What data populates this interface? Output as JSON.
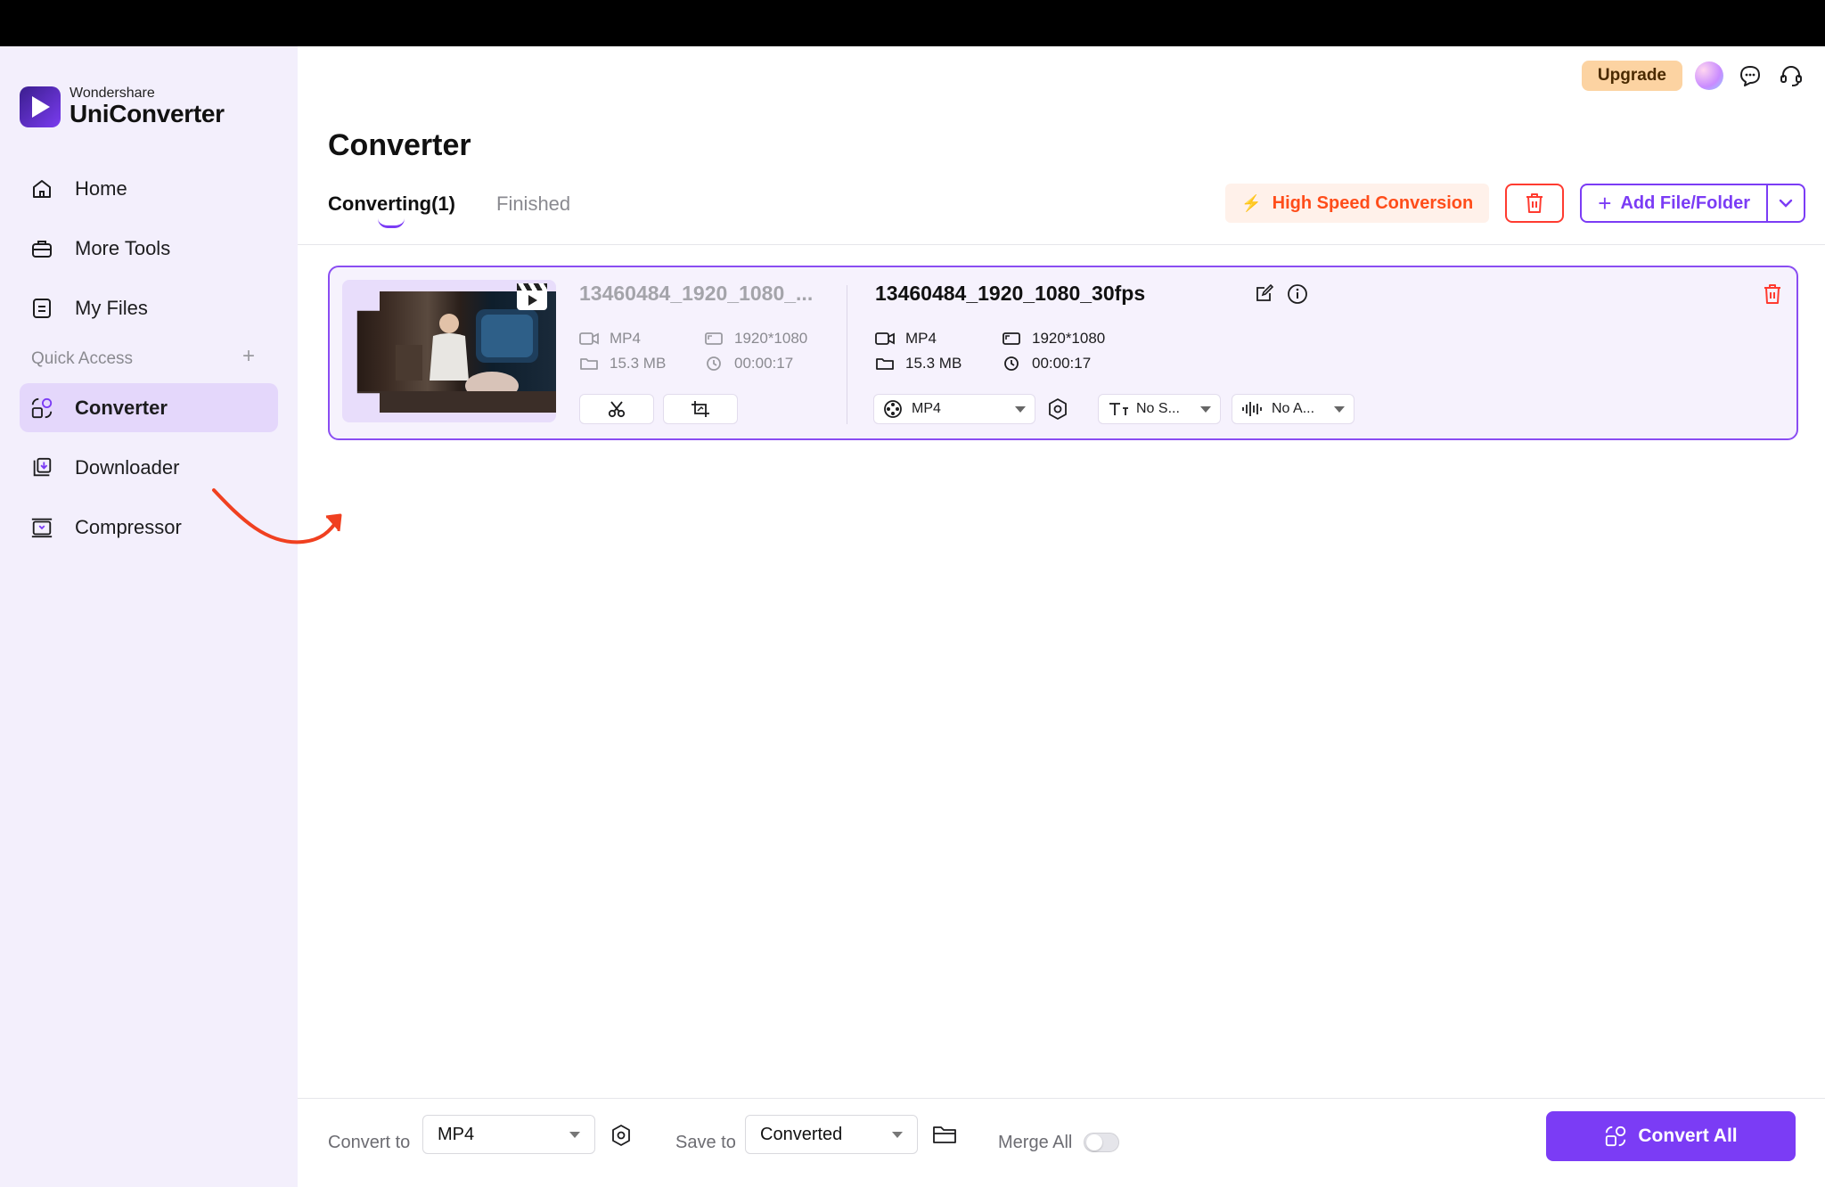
{
  "sidebar": {
    "brand": "Wondershare",
    "product": "UniConverter",
    "nav": [
      {
        "label": "Home",
        "icon": "home-icon"
      },
      {
        "label": "More Tools",
        "icon": "toolbox-icon"
      },
      {
        "label": "My Files",
        "icon": "files-icon"
      }
    ],
    "quick_access_label": "Quick Access",
    "quick_items": [
      {
        "label": "Converter",
        "icon": "converter-icon",
        "active": true
      },
      {
        "label": "Downloader",
        "icon": "downloader-icon"
      },
      {
        "label": "Compressor",
        "icon": "compressor-icon"
      }
    ]
  },
  "header": {
    "upgrade_label": "Upgrade",
    "icons": [
      "avatar",
      "feedback-icon",
      "support-icon"
    ]
  },
  "main": {
    "title": "Converter",
    "tabs": [
      {
        "label": "Converting(1)",
        "active": true
      },
      {
        "label": "Finished",
        "active": false
      }
    ],
    "high_speed_label": "High Speed Conversion",
    "add_label": "Add File/Folder"
  },
  "file": {
    "source": {
      "name": "13460484_1920_1080_...",
      "format": "MP4",
      "resolution": "1920*1080",
      "size": "15.3 MB",
      "duration": "00:00:17"
    },
    "output": {
      "name": "13460484_1920_1080_30fps",
      "format": "MP4",
      "resolution": "1920*1080",
      "size": "15.3 MB",
      "duration": "00:00:17",
      "format_select": "MP4",
      "subtitle_select": "No S...",
      "audio_select": "No A..."
    }
  },
  "bottom": {
    "convert_to_label": "Convert to",
    "convert_to_value": "MP4",
    "save_to_label": "Save to",
    "save_to_value": "Converted",
    "merge_label": "Merge All",
    "merge_on": false,
    "convert_all_label": "Convert All"
  },
  "colors": {
    "accent": "#7b3cf5",
    "danger": "#ff3b30",
    "highspeed": "#ff4d1a",
    "upgrade_bg": "#fcd3a2",
    "sidebar_bg": "#f3effc",
    "annotation": "#f04020"
  }
}
